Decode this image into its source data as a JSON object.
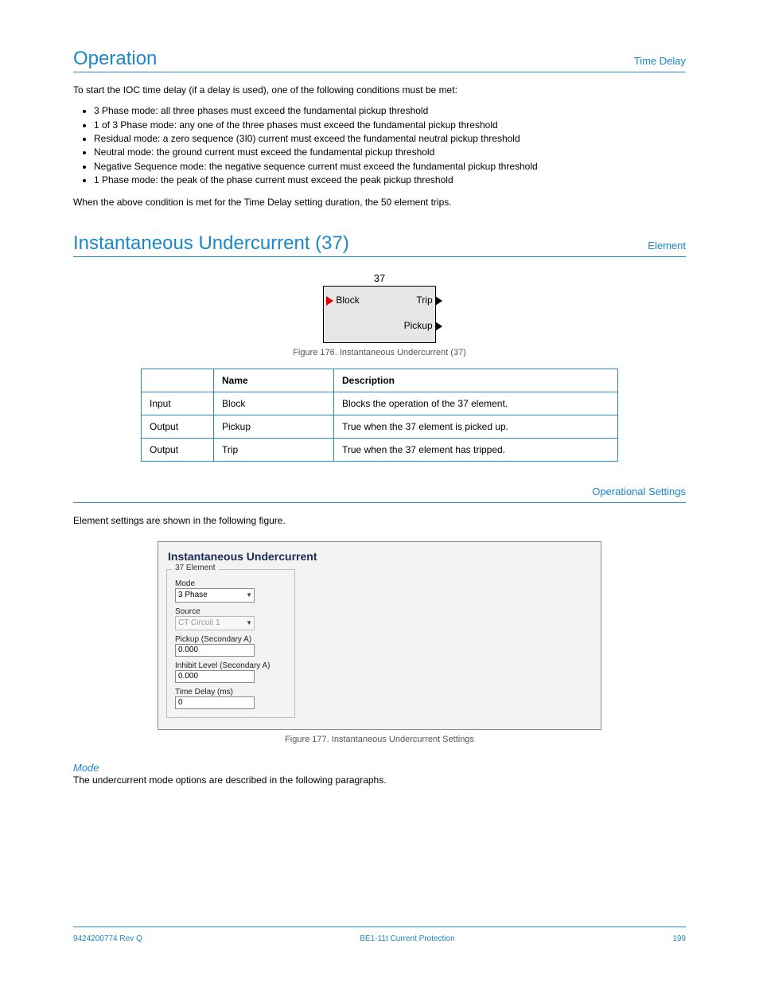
{
  "header1": {
    "title": "Operation",
    "right": "Time Delay"
  },
  "body1": {
    "p1": "To start the IOC time delay (if a delay is used), one of the following conditions must be met:",
    "b1": "3 Phase mode: all three phases must exceed the fundamental pickup threshold",
    "b2": "1 of 3 Phase mode: any one of the three phases must exceed the fundamental pickup threshold",
    "b3": "Residual mode: a zero sequence (3I0) current must exceed the fundamental neutral pickup threshold",
    "b4": "Neutral mode: the ground current must exceed the fundamental pickup threshold",
    "b5": "Negative Sequence mode: the negative sequence current must exceed the fundamental pickup threshold",
    "b6": "1 Phase mode: the peak of the phase current must exceed the peak pickup threshold",
    "p2": "When the above condition is met for the Time Delay setting duration, the 50 element trips."
  },
  "header2": {
    "title": "Instantaneous Undercurrent (37)",
    "right": "Element"
  },
  "element_box": {
    "name": "37",
    "block": "Block",
    "trip": "Trip",
    "pickup": "Pickup",
    "figcap": "Figure 176. Instantaneous Undercurrent (37)"
  },
  "iotable": {
    "head": [
      "",
      "Name",
      "Description"
    ],
    "rows": [
      [
        "Input",
        "Block",
        "Blocks the operation of the 37 element."
      ],
      [
        "Output",
        "Pickup",
        "True when the 37 element is picked up."
      ],
      [
        "Output",
        "Trip",
        "True when the 37 element has tripped."
      ]
    ]
  },
  "header3": {
    "right": "Operational Settings"
  },
  "body3": {
    "p1": "Element settings are shown in the following figure."
  },
  "gui": {
    "title": "Instantaneous Undercurrent",
    "legend": "37 Element",
    "mode_label": "Mode",
    "mode_value": "3 Phase",
    "source_label": "Source",
    "source_value": "CT Circuit 1",
    "pickup_label": "Pickup (Secondary A)",
    "pickup_value": "0.000",
    "inhibit_label": "Inhibit Level (Secondary A)",
    "inhibit_value": "0.000",
    "delay_label": "Time Delay (ms)",
    "delay_value": "0",
    "figcap": "Figure 177. Instantaneous Undercurrent Settings"
  },
  "section_mode": {
    "title": "Mode",
    "p1": "The undercurrent mode options are described in the following paragraphs."
  },
  "footer": {
    "left": "9424200774 Rev Q",
    "right": "199",
    "center": "BE1-11t  Current Protection"
  }
}
